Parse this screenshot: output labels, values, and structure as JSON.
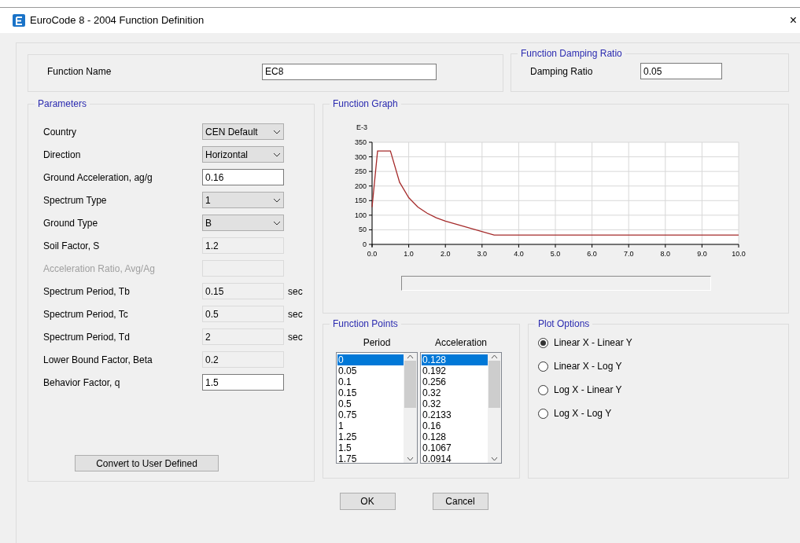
{
  "window": {
    "title": "EuroCode 8 - 2004 Function Definition",
    "close": "×"
  },
  "function_name": {
    "label": "Function Name",
    "value": "EC8"
  },
  "damping": {
    "title": "Function Damping Ratio",
    "label": "Damping Ratio",
    "value": "0.05"
  },
  "parameters": {
    "title": "Parameters",
    "rows": [
      {
        "label": "Country",
        "kind": "combo",
        "value": "CEN Default",
        "disabled": false
      },
      {
        "label": "Direction",
        "kind": "combo",
        "value": "Horizontal",
        "disabled": false
      },
      {
        "label": "Ground Acceleration, ag/g",
        "kind": "text",
        "value": "0.16",
        "disabled": false
      },
      {
        "label": "Spectrum Type",
        "kind": "combo",
        "value": "1",
        "disabled": false
      },
      {
        "label": "Ground Type",
        "kind": "combo",
        "value": "B",
        "disabled": false
      },
      {
        "label": "Soil Factor, S",
        "kind": "readonly",
        "value": "1.2",
        "disabled": false
      },
      {
        "label": "Acceleration Ratio, Avg/Ag",
        "kind": "readonly",
        "disabled": true
      },
      {
        "label": "Spectrum Period, Tb",
        "kind": "readonly",
        "value": "0.15",
        "unit": "sec",
        "disabled": false
      },
      {
        "label": "Spectrum Period, Tc",
        "kind": "readonly",
        "value": "0.5",
        "unit": "sec",
        "disabled": false
      },
      {
        "label": "Spectrum Period, Td",
        "kind": "readonly",
        "value": "2",
        "unit": "sec",
        "disabled": false
      },
      {
        "label": "Lower Bound Factor, Beta",
        "kind": "readonly",
        "value": "0.2",
        "disabled": false
      },
      {
        "label": "Behavior Factor, q",
        "kind": "text",
        "value": "1.5",
        "disabled": false
      }
    ],
    "button": "Convert to User Defined"
  },
  "graph": {
    "title": "Function Graph",
    "chart_data": {
      "type": "line",
      "ylabel": "E-3",
      "grid": true,
      "x": [
        0,
        0.05,
        0.1,
        0.15,
        0.5,
        0.75,
        1,
        1.25,
        1.5,
        1.75,
        2,
        3.33,
        10
      ],
      "series": [
        {
          "color": "#a52a2a",
          "values": [
            128,
            192,
            256,
            320,
            320,
            213,
            160,
            128,
            107,
            91,
            80,
            32,
            32
          ]
        }
      ],
      "xlim": [
        0,
        10
      ],
      "ylim": [
        0,
        350
      ],
      "xticks": [
        {
          "value": 0,
          "label": "0.0"
        },
        {
          "value": 1,
          "label": "1.0"
        },
        {
          "value": 2,
          "label": "2.0"
        },
        {
          "value": 3,
          "label": "3.0"
        },
        {
          "value": 4,
          "label": "4.0"
        },
        {
          "value": 5,
          "label": "5.0"
        },
        {
          "value": 6,
          "label": "6.0"
        },
        {
          "value": 7,
          "label": "7.0"
        },
        {
          "value": 8,
          "label": "8.0"
        },
        {
          "value": 9,
          "label": "9.0"
        },
        {
          "value": 10,
          "label": "10.0"
        }
      ],
      "yticks": [
        0,
        50,
        100,
        150,
        200,
        250,
        300,
        350
      ]
    }
  },
  "function_points": {
    "title": "Function Points",
    "columns": [
      {
        "header": "Period",
        "items": [
          {
            "text": "0",
            "selected": true
          },
          {
            "text": "0.05",
            "selected": false
          },
          {
            "text": "0.1",
            "selected": false
          },
          {
            "text": "0.15",
            "selected": false
          },
          {
            "text": "0.5",
            "selected": false
          },
          {
            "text": "0.75",
            "selected": false
          },
          {
            "text": "1",
            "selected": false
          },
          {
            "text": "1.25",
            "selected": false
          },
          {
            "text": "1.5",
            "selected": false
          },
          {
            "text": "1.75",
            "selected": false
          }
        ]
      },
      {
        "header": "Acceleration",
        "items": [
          {
            "text": "0.128",
            "selected": true
          },
          {
            "text": "0.192",
            "selected": false
          },
          {
            "text": "0.256",
            "selected": false
          },
          {
            "text": "0.32",
            "selected": false
          },
          {
            "text": "0.32",
            "selected": false
          },
          {
            "text": "0.2133",
            "selected": false
          },
          {
            "text": "0.16",
            "selected": false
          },
          {
            "text": "0.128",
            "selected": false
          },
          {
            "text": "0.1067",
            "selected": false
          },
          {
            "text": "0.0914",
            "selected": false
          }
        ]
      }
    ]
  },
  "plot_options": {
    "title": "Plot Options",
    "options": [
      {
        "label": "Linear X - Linear Y",
        "selected": true
      },
      {
        "label": "Linear X - Log Y",
        "selected": false
      },
      {
        "label": "Log X - Linear Y",
        "selected": false
      },
      {
        "label": "Log X - Log Y",
        "selected": false
      }
    ]
  },
  "buttons": [
    "OK",
    "Cancel"
  ]
}
